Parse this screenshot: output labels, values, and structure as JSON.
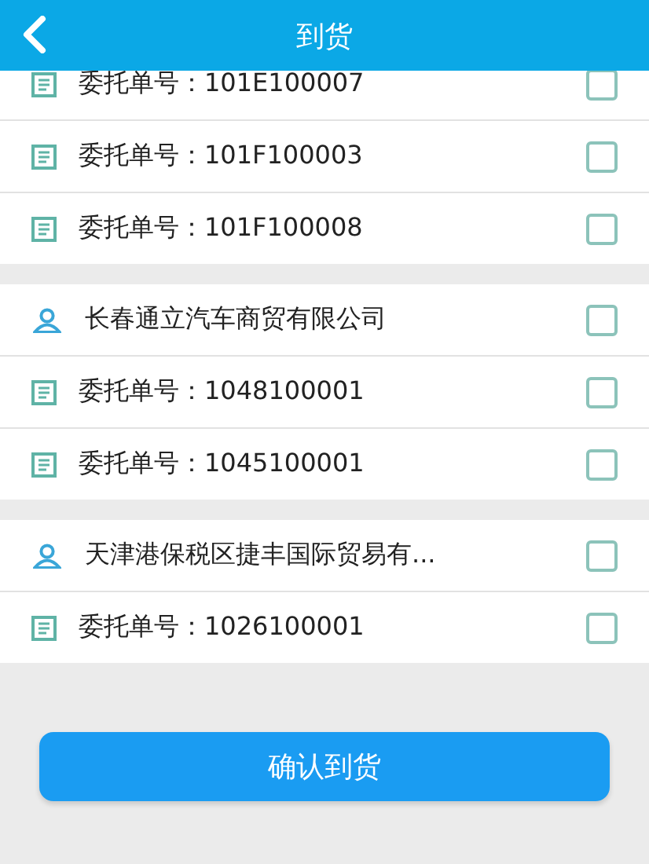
{
  "header": {
    "title": "到货"
  },
  "groups": [
    {
      "items": [
        {
          "kind": "order",
          "text": "委托单号：101E100007",
          "checked": false
        },
        {
          "kind": "order",
          "text": "委托单号：101F100003",
          "checked": false
        },
        {
          "kind": "order",
          "text": "委托单号：101F100008",
          "checked": false
        }
      ]
    },
    {
      "items": [
        {
          "kind": "customer",
          "text": "长春通立汽车商贸有限公司",
          "checked": false
        },
        {
          "kind": "order",
          "text": "委托单号：1048100001",
          "checked": false
        },
        {
          "kind": "order",
          "text": "委托单号：1045100001",
          "checked": false
        }
      ]
    },
    {
      "items": [
        {
          "kind": "customer",
          "text": "天津港保税区捷丰国际贸易有...",
          "checked": false
        },
        {
          "kind": "order",
          "text": "委托单号：1026100001",
          "checked": false
        }
      ]
    }
  ],
  "confirm_button": "确认到货"
}
